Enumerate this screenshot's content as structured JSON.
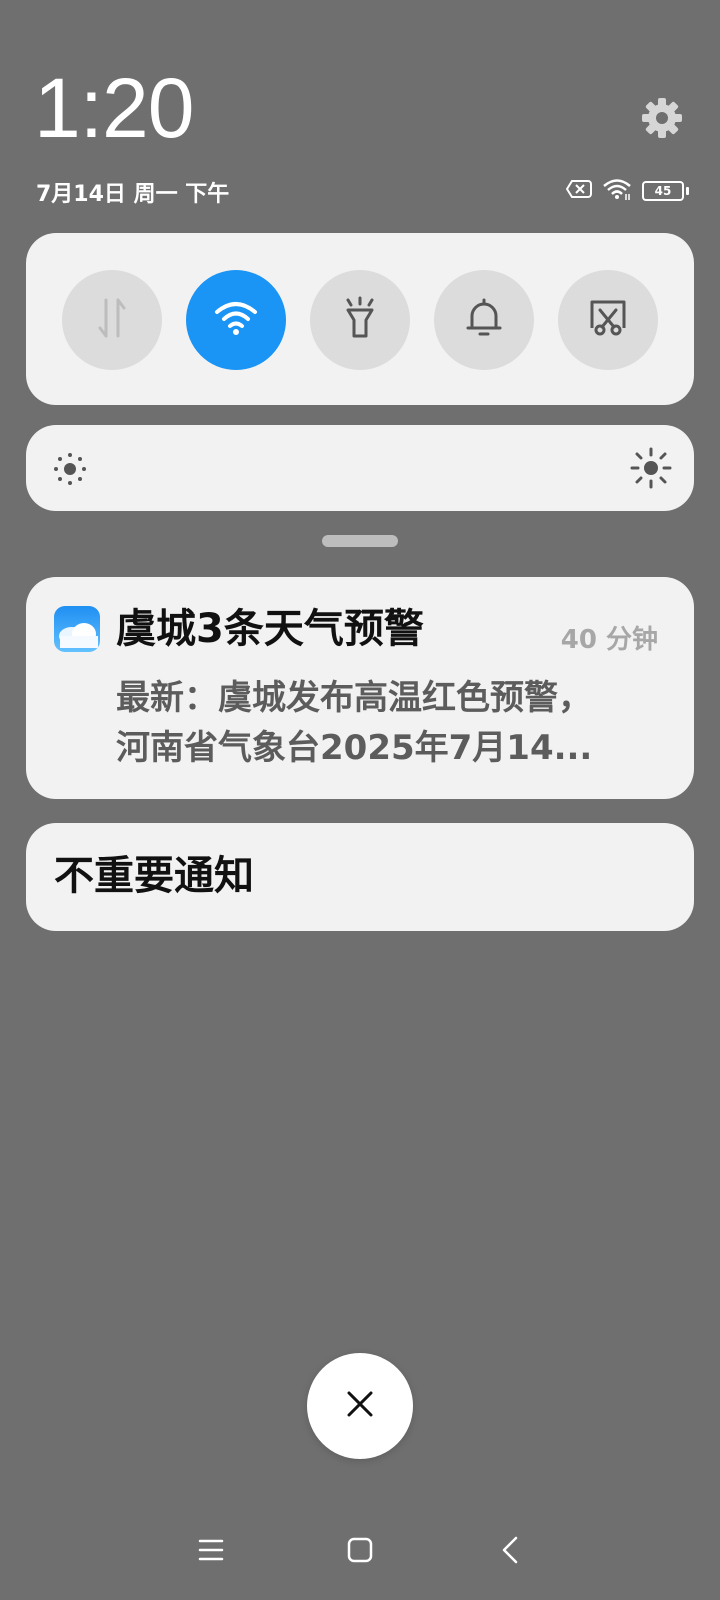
{
  "status": {
    "time": "1:20",
    "date": "7月14日 周一 下午",
    "battery_level": "45",
    "icons": [
      "no-sim-icon",
      "wifi-signal-icon",
      "battery-icon"
    ]
  },
  "quick_settings": {
    "toggles": [
      {
        "name": "mobile-data",
        "icon": "mobile-data-arrows-icon",
        "active": false
      },
      {
        "name": "wifi",
        "icon": "wifi-icon",
        "active": true
      },
      {
        "name": "flashlight",
        "icon": "flashlight-icon",
        "active": false
      },
      {
        "name": "sound",
        "icon": "bell-icon",
        "active": false
      },
      {
        "name": "screenshot",
        "icon": "screenshot-scissors-icon",
        "active": false
      }
    ]
  },
  "brightness": {
    "low_icon": "brightness-low-icon",
    "high_icon": "brightness-high-icon"
  },
  "notification": {
    "app_icon": "weather-app-icon",
    "title": "虞城3条天气预警",
    "time": "40 分钟",
    "body_line1": "最新：虞城发布高温红色预警，",
    "body_line2": "河南省气象台2025年7月14..."
  },
  "unimportant": {
    "label": "不重要通知"
  },
  "colors": {
    "accent": "#1a94f5",
    "card_bg": "#f2f2f2",
    "overlay_bg": "#6f6f6f"
  }
}
